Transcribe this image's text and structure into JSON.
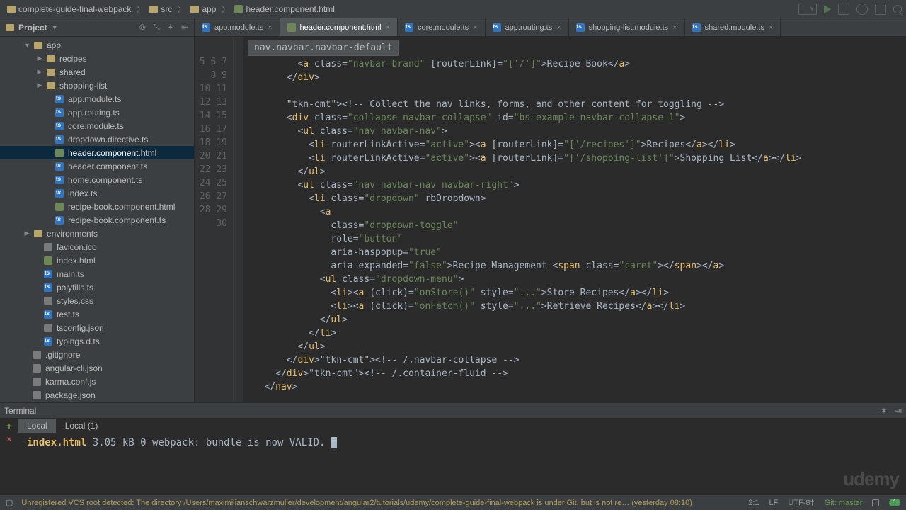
{
  "breadcrumbs": [
    {
      "icon": "folder",
      "label": "complete-guide-final-webpack"
    },
    {
      "icon": "folder",
      "label": "src"
    },
    {
      "icon": "folder",
      "label": "app"
    },
    {
      "icon": "html",
      "label": "header.component.html"
    }
  ],
  "project": {
    "title": "Project",
    "tree": [
      {
        "indent": 34,
        "arrow": "down",
        "icon": "folder",
        "label": "app"
      },
      {
        "indent": 52,
        "arrow": "right",
        "icon": "folder",
        "label": "recipes"
      },
      {
        "indent": 52,
        "arrow": "right",
        "icon": "folder",
        "label": "shared"
      },
      {
        "indent": 52,
        "arrow": "right",
        "icon": "folder",
        "label": "shopping-list"
      },
      {
        "indent": 64,
        "arrow": "none",
        "icon": "ts",
        "label": "app.module.ts"
      },
      {
        "indent": 64,
        "arrow": "none",
        "icon": "ts",
        "label": "app.routing.ts"
      },
      {
        "indent": 64,
        "arrow": "none",
        "icon": "ts",
        "label": "core.module.ts"
      },
      {
        "indent": 64,
        "arrow": "none",
        "icon": "ts",
        "label": "dropdown.directive.ts"
      },
      {
        "indent": 64,
        "arrow": "none",
        "icon": "html",
        "label": "header.component.html",
        "selected": true
      },
      {
        "indent": 64,
        "arrow": "none",
        "icon": "ts",
        "label": "header.component.ts"
      },
      {
        "indent": 64,
        "arrow": "none",
        "icon": "ts",
        "label": "home.component.ts"
      },
      {
        "indent": 64,
        "arrow": "none",
        "icon": "ts",
        "label": "index.ts"
      },
      {
        "indent": 64,
        "arrow": "none",
        "icon": "html",
        "label": "recipe-book.component.html"
      },
      {
        "indent": 64,
        "arrow": "none",
        "icon": "ts",
        "label": "recipe-book.component.ts"
      },
      {
        "indent": 34,
        "arrow": "right",
        "icon": "folder",
        "label": "environments"
      },
      {
        "indent": 48,
        "arrow": "none",
        "icon": "generic",
        "label": "favicon.ico"
      },
      {
        "indent": 48,
        "arrow": "none",
        "icon": "html",
        "label": "index.html"
      },
      {
        "indent": 48,
        "arrow": "none",
        "icon": "ts",
        "label": "main.ts"
      },
      {
        "indent": 48,
        "arrow": "none",
        "icon": "ts",
        "label": "polyfills.ts"
      },
      {
        "indent": 48,
        "arrow": "none",
        "icon": "generic",
        "label": "styles.css"
      },
      {
        "indent": 48,
        "arrow": "none",
        "icon": "ts",
        "label": "test.ts"
      },
      {
        "indent": 48,
        "arrow": "none",
        "icon": "generic",
        "label": "tsconfig.json"
      },
      {
        "indent": 48,
        "arrow": "none",
        "icon": "ts",
        "label": "typings.d.ts"
      },
      {
        "indent": 32,
        "arrow": "none",
        "icon": "generic",
        "label": ".gitignore"
      },
      {
        "indent": 32,
        "arrow": "none",
        "icon": "generic",
        "label": "angular-cli.json"
      },
      {
        "indent": 32,
        "arrow": "none",
        "icon": "generic",
        "label": "karma.conf.js"
      },
      {
        "indent": 32,
        "arrow": "none",
        "icon": "generic",
        "label": "package.json"
      }
    ]
  },
  "editor": {
    "tabs": [
      {
        "icon": "ts",
        "label": "app.module.ts"
      },
      {
        "icon": "html",
        "label": "header.component.html",
        "active": true
      },
      {
        "icon": "ts",
        "label": "core.module.ts"
      },
      {
        "icon": "ts",
        "label": "app.routing.ts"
      },
      {
        "icon": "ts",
        "label": "shopping-list.module.ts"
      },
      {
        "icon": "ts",
        "label": "shared.module.ts"
      }
    ],
    "breadcrumb": "nav.navbar.navbar-default",
    "startLine": 5,
    "endLine": 30,
    "code": [
      "         <a class=\"navbar-brand\" [routerLink]=\"['/']\">Recipe Book</a>",
      "       </div>",
      "",
      "       <!-- Collect the nav links, forms, and other content for toggling -->",
      "       <div class=\"collapse navbar-collapse\" id=\"bs-example-navbar-collapse-1\">",
      "         <ul class=\"nav navbar-nav\">",
      "           <li routerLinkActive=\"active\"><a [routerLink]=\"['/recipes']\">Recipes</a></li>",
      "           <li routerLinkActive=\"active\"><a [routerLink]=\"['/shopping-list']\">Shopping List</a></li>",
      "         </ul>",
      "         <ul class=\"nav navbar-nav navbar-right\">",
      "           <li class=\"dropdown\" rbDropdown>",
      "             <a",
      "               class=\"dropdown-toggle\"",
      "               role=\"button\"",
      "               aria-haspopup=\"true\"",
      "               aria-expanded=\"false\">Recipe Management <span class=\"caret\"></span></a>",
      "             <ul class=\"dropdown-menu\">",
      "               <li><a (click)=\"onStore()\" style=\"...\">Store Recipes</a></li>",
      "               <li><a (click)=\"onFetch()\" style=\"...\">Retrieve Recipes</a></li>",
      "             </ul>",
      "           </li>",
      "         </ul>",
      "       </div><!-- /.navbar-collapse -->",
      "     </div><!-- /.container-fluid -->",
      "   </nav>",
      ""
    ]
  },
  "terminal": {
    "title": "Terminal",
    "tabs": [
      {
        "label": "Local",
        "active": true
      },
      {
        "label": "Local (1)"
      }
    ],
    "lines": [
      {
        "file": "index.html",
        "size": "3.05 kB",
        "col": "0"
      },
      {
        "raw": "webpack: bundle is now VALID."
      }
    ]
  },
  "status": {
    "message": "Unregistered VCS root detected: The directory /Users/maximilianschwarzmuller/development/angular2/tutorials/udemy/complete-guide-final-webpack is under Git, but is not re… (yesterday 08:10)",
    "pos": "2:1",
    "lf": "LF",
    "enc": "UTF-8",
    "git": "Git: master",
    "badge": "1"
  },
  "watermark": "udemy"
}
